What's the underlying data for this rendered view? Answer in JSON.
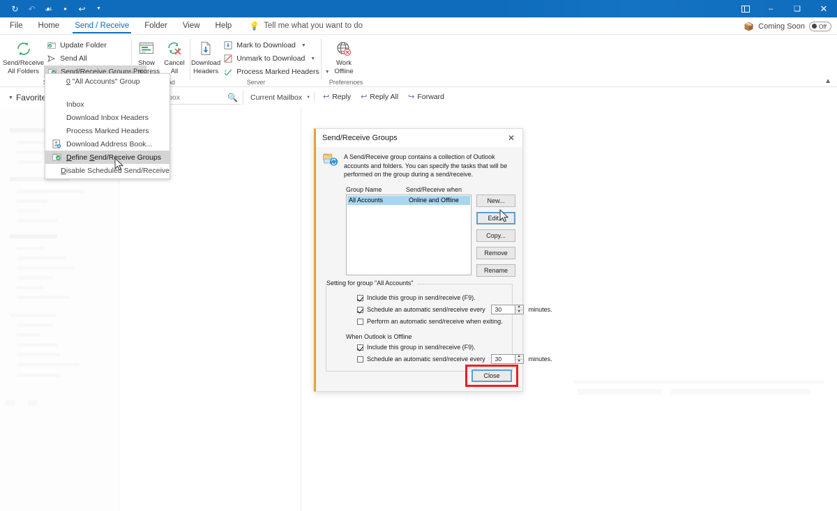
{
  "window": {
    "quick_access": [
      "refresh-icon",
      "undo-dim-icon",
      "touch-mode-icon",
      "dot-icon",
      "undo-icon",
      "customize-caret-icon"
    ],
    "controls": {
      "ribbon_display": "ribbon-display-icon",
      "minimize": "–",
      "maximize": "❑",
      "close": "✕"
    }
  },
  "tabs": [
    {
      "label": "File",
      "active": false
    },
    {
      "label": "Home",
      "active": false
    },
    {
      "label": "Send / Receive",
      "active": true
    },
    {
      "label": "Folder",
      "active": false
    },
    {
      "label": "View",
      "active": false
    },
    {
      "label": "Help",
      "active": false
    }
  ],
  "tell_me": {
    "placeholder": "Tell me what you want to do",
    "icon": "lightbulb-icon"
  },
  "coming_soon": {
    "label": "Coming Soon",
    "icon": "box-icon",
    "toggle_state": "Off"
  },
  "ribbon": {
    "groups": [
      {
        "label": "Send & Receive",
        "big_buttons": [
          {
            "caption_line1": "Send/Receive",
            "caption_line2": "All Folders",
            "icon": "send-receive-all-icon"
          }
        ],
        "small_buttons": [
          {
            "label": "Update Folder",
            "icon": "update-folder-icon",
            "has_caret": false
          },
          {
            "label": "Send All",
            "icon": "send-all-icon",
            "has_caret": false
          },
          {
            "label": "Send/Receive Groups",
            "icon": "send-receive-groups-icon",
            "has_caret": true,
            "active": true
          }
        ]
      },
      {
        "label": "Download",
        "big_buttons": [
          {
            "caption_line1": "Show",
            "caption_line2": "Progress",
            "icon": "show-progress-icon"
          },
          {
            "caption_line1": "Cancel",
            "caption_line2": "All",
            "icon": "cancel-all-icon"
          }
        ],
        "small_buttons": []
      },
      {
        "label": "Server",
        "big_buttons": [
          {
            "caption_line1": "Download",
            "caption_line2": "Headers",
            "icon": "download-headers-icon"
          }
        ],
        "small_buttons": [
          {
            "label": "Mark to Download",
            "icon": "mark-to-download-icon",
            "has_caret": true
          },
          {
            "label": "Unmark to Download",
            "icon": "unmark-to-download-icon",
            "has_caret": true
          },
          {
            "label": "Process Marked Headers",
            "icon": "process-marked-headers-icon",
            "has_caret": true
          }
        ]
      },
      {
        "label": "Preferences",
        "big_buttons": [
          {
            "caption_line1": "Work",
            "caption_line2": "Offline",
            "icon": "work-offline-icon"
          }
        ],
        "small_buttons": []
      }
    ],
    "collapse_icon": "chevron-up-icon"
  },
  "dropdown": {
    "items": [
      {
        "label": "\"All Accounts\" Group",
        "icon": "all-accounts-group-icon",
        "accel": "0",
        "disabled": true,
        "separator_after": true
      },
      {
        "label": "Inbox",
        "icon": null,
        "disabled": true
      },
      {
        "label": "Download Inbox Headers",
        "icon": null,
        "disabled": true
      },
      {
        "label": "Process Marked Headers",
        "icon": null,
        "disabled": true
      },
      {
        "label": "Download Address Book...",
        "icon": "download-address-book-icon",
        "disabled": false
      },
      {
        "label": "Define Send/Receive Groups",
        "icon": "define-groups-icon",
        "highlighted": true
      },
      {
        "label": "Disable Scheduled Send/Receive",
        "icon": null,
        "disabled": false
      }
    ]
  },
  "mail_pane": {
    "favorites_label": "Favorites",
    "search_placeholder": "Current Mailbox",
    "search_icon": "search-icon",
    "scope_label": "Current Mailbox",
    "scope_caret": "chevron-down-icon",
    "actions": [
      {
        "label": "Reply",
        "icon": "reply-icon"
      },
      {
        "label": "Reply All",
        "icon": "reply-all-icon"
      },
      {
        "label": "Forward",
        "icon": "forward-icon"
      }
    ]
  },
  "dialog": {
    "title": "Send/Receive Groups",
    "close_icon": "close-icon",
    "info_icon": "send-receive-groups-large-icon",
    "description": "A Send/Receive group contains a collection of Outlook accounts and folders. You can specify the tasks that will be performed on the group during a send/receive.",
    "columns": {
      "name": "Group Name",
      "when": "Send/Receive when"
    },
    "groups": [
      {
        "name": "All Accounts",
        "when": "Online and Offline",
        "selected": true
      }
    ],
    "side_buttons": [
      {
        "label": "New...",
        "focused": false
      },
      {
        "label": "Edit...",
        "focused": true
      },
      {
        "label": "Copy...",
        "focused": false
      },
      {
        "label": "Remove",
        "focused": false
      },
      {
        "label": "Rename",
        "focused": false
      }
    ],
    "settings": {
      "legend": "Setting for group \"All Accounts\"",
      "online": [
        {
          "label": "Include this group in send/receive (F9).",
          "checked": true,
          "spinner": null
        },
        {
          "label": "Schedule an automatic send/receive every",
          "checked": true,
          "spinner": {
            "value": "30",
            "unit": "minutes."
          }
        },
        {
          "label": "Perform an automatic send/receive when exiting.",
          "checked": false,
          "spinner": null
        }
      ],
      "offline_heading": "When Outlook is Offline",
      "offline": [
        {
          "label": "Include this group in send/receive (F9).",
          "checked": true,
          "spinner": null
        },
        {
          "label": "Schedule an automatic send/receive every",
          "checked": false,
          "spinner": {
            "value": "30",
            "unit": "minutes."
          }
        }
      ]
    },
    "close_button": {
      "label": "Close",
      "highlight_color": "#ee1c1c"
    }
  },
  "colors": {
    "titlebar": "#0f6cbd",
    "accent": "#0f6cbd",
    "dialog_accent": "#e0a438",
    "selection": "#a8d6f0",
    "highlight_red": "#ee1c1c",
    "menu_highlight": "#d4d4d4"
  }
}
